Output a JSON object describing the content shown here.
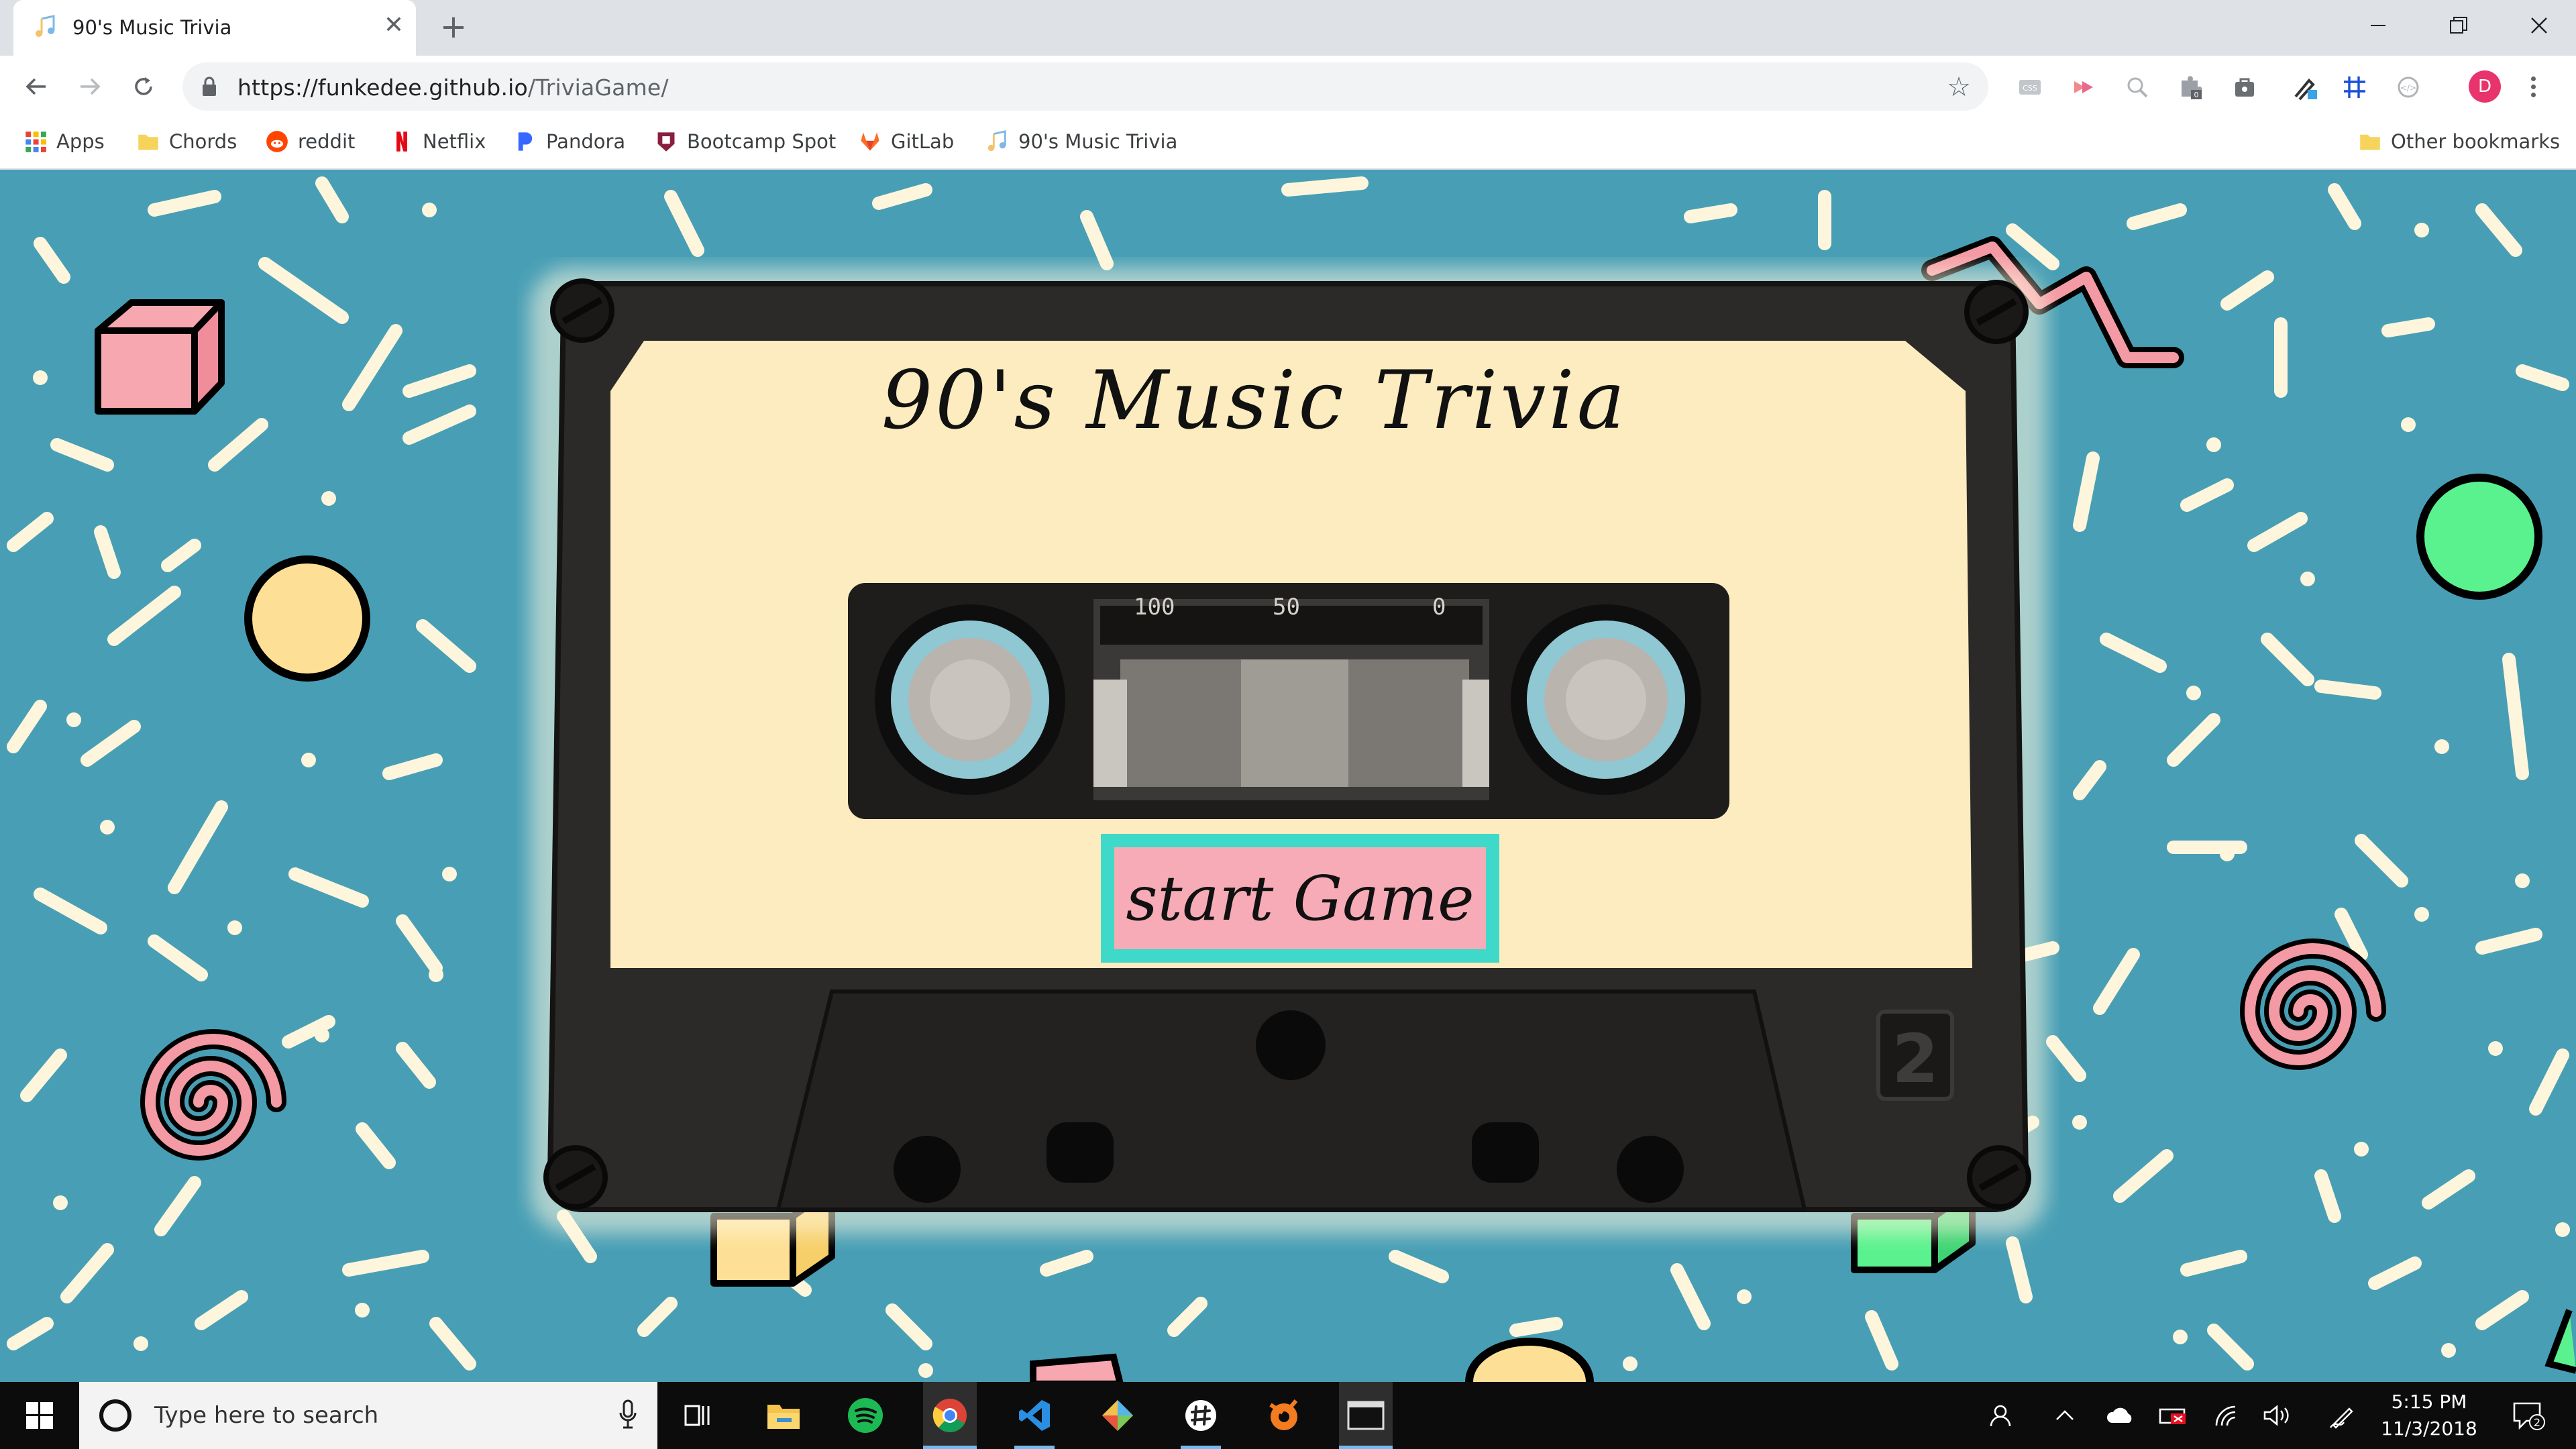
{
  "browser": {
    "tab_title": "90's Music Trivia",
    "tab_close": "✕",
    "new_tab": "+",
    "url_host": "https://funkedee.github.io",
    "url_path": "/TriviaGame/",
    "avatar_initial": "D"
  },
  "bookmarks": [
    {
      "label": "Apps",
      "icon": "apps-grid-icon"
    },
    {
      "label": "Chords",
      "icon": "folder-icon"
    },
    {
      "label": "reddit",
      "icon": "reddit-icon"
    },
    {
      "label": "Netflix",
      "icon": "netflix-icon"
    },
    {
      "label": "Pandora",
      "icon": "pandora-icon"
    },
    {
      "label": "Bootcamp Spot",
      "icon": "bootcamp-icon"
    },
    {
      "label": "GitLab",
      "icon": "gitlab-icon"
    },
    {
      "label": "90's Music Trivia",
      "icon": "music-note-icon"
    }
  ],
  "other_bookmarks": "Other bookmarks",
  "page": {
    "title": "90's Music Trivia",
    "start_button": "start Game",
    "counter_labels": [
      "100",
      "50",
      "0"
    ],
    "side_number": "2"
  },
  "taskbar": {
    "search_placeholder": "Type here to search",
    "time": "5:15 PM",
    "date": "11/3/2018",
    "notification_count": "2"
  },
  "colors": {
    "page_bg": "#489fb5",
    "label": "#fdf0c4",
    "button_bg": "#f7abb7",
    "button_border": "#3fd9c9",
    "accent_pink": "#e8336d"
  }
}
